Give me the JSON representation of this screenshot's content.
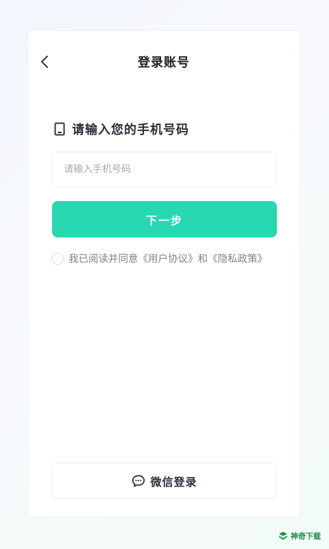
{
  "header": {
    "title": "登录账号",
    "back_icon": "chevron-left-icon"
  },
  "form": {
    "section_icon": "mobile-phone-icon",
    "section_title": "请输入您的手机号码",
    "phone_value": "",
    "phone_placeholder": "请输入手机号码",
    "next_label": "下一步",
    "agreement_checked": false,
    "agreement_prefix": "我已阅读并同意",
    "agreement_user": "《用户协议》",
    "agreement_and": "和",
    "agreement_privacy": "《隐私政策》"
  },
  "wechat": {
    "icon": "chat-bubble-icon",
    "label": "微信登录"
  },
  "watermark": {
    "logo": "watermark-logo",
    "text": "神奇下载"
  },
  "colors": {
    "accent": "#27d8b0",
    "watermark": "#1f8a4c"
  }
}
